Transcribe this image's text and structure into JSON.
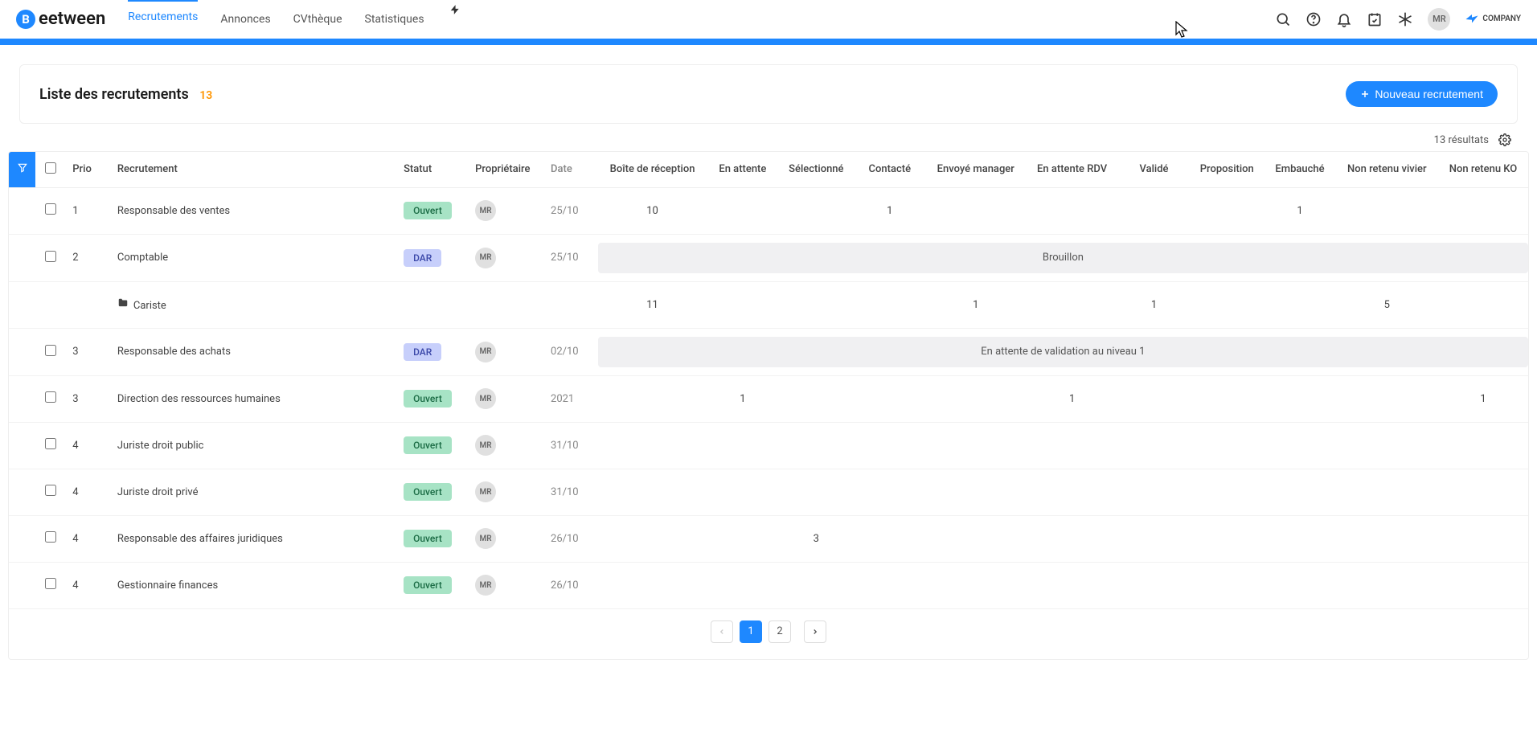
{
  "brand": "eetween",
  "brand_initial": "B",
  "nav": {
    "recrutements": "Recrutements",
    "annonces": "Annonces",
    "cvtheque": "CVthèque",
    "statistiques": "Statistiques"
  },
  "avatar_initials": "MR",
  "company_label": "COMPANY",
  "page": {
    "title": "Liste des recrutements",
    "count": "13",
    "new_button": "Nouveau recrutement",
    "results_text": "13 résultats"
  },
  "columns": {
    "prio": "Prio",
    "recrutement": "Recrutement",
    "statut": "Statut",
    "proprietaire": "Propriétaire",
    "date": "Date",
    "boite": "Boîte de réception",
    "attente": "En attente",
    "selectionne": "Sélectionné",
    "contacte": "Contacté",
    "envoye_manager": "Envoyé manager",
    "attente_rdv": "En attente RDV",
    "valide": "Validé",
    "proposition": "Proposition",
    "embauche": "Embauché",
    "non_retenu_vivier": "Non retenu vivier",
    "non_retenu_ko": "Non retenu KO"
  },
  "status_labels": {
    "ouvert": "Ouvert",
    "dar": "DAR"
  },
  "banners": {
    "brouillon": "Brouillon",
    "validation": "En attente de validation au niveau 1"
  },
  "rows": [
    {
      "prio": "1",
      "name": "Responsable des ventes",
      "status": "ouvert",
      "owner": "MR",
      "date": "25/10",
      "boite": "10",
      "contacte": "1",
      "embauche": "1"
    },
    {
      "prio": "2",
      "name": "Comptable",
      "status": "dar",
      "owner": "MR",
      "date": "25/10",
      "banner": "brouillon"
    },
    {
      "folder": true,
      "name": "Cariste",
      "boite": "11",
      "envoye_manager": "1",
      "valide": "1",
      "non_retenu_vivier": "5"
    },
    {
      "prio": "3",
      "name": "Responsable des achats",
      "status": "dar",
      "owner": "MR",
      "date": "02/10",
      "banner": "validation"
    },
    {
      "prio": "3",
      "name": "Direction des ressources humaines",
      "status": "ouvert",
      "owner": "MR",
      "date": "2021",
      "attente": "1",
      "attente_rdv": "1",
      "non_retenu_ko": "1"
    },
    {
      "prio": "4",
      "name": "Juriste droit public",
      "status": "ouvert",
      "owner": "MR",
      "date": "31/10"
    },
    {
      "prio": "4",
      "name": "Juriste droit privé",
      "status": "ouvert",
      "owner": "MR",
      "date": "31/10"
    },
    {
      "prio": "4",
      "name": "Responsable des affaires juridiques",
      "status": "ouvert",
      "owner": "MR",
      "date": "26/10",
      "selectionne": "3"
    },
    {
      "prio": "4",
      "name": "Gestionnaire finances",
      "status": "ouvert",
      "owner": "MR",
      "date": "26/10"
    }
  ],
  "pagination": {
    "pages": [
      "1",
      "2"
    ],
    "active": 1
  }
}
